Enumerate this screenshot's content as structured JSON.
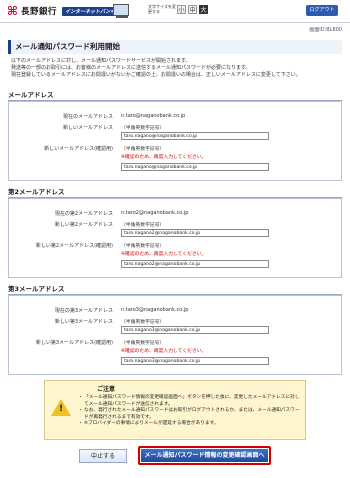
{
  "header": {
    "bank_name": "長野銀行",
    "service_badge": "インターネットバンキング",
    "font_size_label": "文字サイズを変更する",
    "font_sizes": [
      "小",
      "中",
      "大"
    ],
    "logout_label": "ログアウト"
  },
  "screen_id": "画面ID:BL800",
  "title": "メール通知パスワード利用開始",
  "intro_lines": [
    "以下のメールアドレスに対し、メール通知パスワードサービスが開始されます。",
    "発送等の一部のお取引には、お客様のメールアドレスに送信するメール通知パスワードが必要になります。",
    "現在登録しているメールアドレスにお間違いがないかご確認の上、お間違いの場合は、正しいメールアドレスに変更して下さい。"
  ],
  "sections": [
    {
      "heading": "メールアドレス",
      "current_label": "現在のメールアドレス",
      "current_value": "n.taro@naganobank.co.jp",
      "new_label": "新しいメールアドレス",
      "hint": "（半角英数字記号）",
      "new_value": "taro.nagano@naganobank.co.jp",
      "confirm_label": "新しいメールアドレス(確認用)",
      "confirm_note": "※確認のため、再度入力してください。",
      "confirm_value": "taro.nagano@naganobank.co.jp"
    },
    {
      "heading": "第2メールアドレス",
      "current_label": "現在の第2メールアドレス",
      "current_value": "n.taro2@naganobank.co.jp",
      "new_label": "新しい第2メールアドレス",
      "hint": "（半角英数字記号）",
      "new_value": "taro.nagano2@naganobank.co.jp",
      "confirm_label": "新しい第2メールアドレス(確認用)",
      "confirm_note": "※確認のため、再度入力してください。",
      "confirm_value": "taro.nagano2@naganobank.co.jp"
    },
    {
      "heading": "第3メールアドレス",
      "current_label": "現在の第3メールアドレス",
      "current_value": "n.taro3@naganobank.co.jp",
      "new_label": "新しい第3メールアドレス",
      "hint": "（半角英数字記号）",
      "new_value": "taro.nagano3@naganobank.co.jp",
      "confirm_label": "新しい第3メールアドレス(確認用)",
      "confirm_note": "※確認のため、再度入力してください。",
      "confirm_value": "taro.nagano3@naganobank.co.jp"
    }
  ],
  "caution": {
    "heading": "ご注意",
    "items": [
      "「メール通知パスワード情報の変更確認画面へ」ボタンを押した後に、変更したメールアドレスに対してメール通知パスワードが送信されます。",
      "なお、発行されたメール通知パスワードはお取引がログアウトされるか、または、メール通知パスワードが再発行されるまで有効です。",
      "※プロバイダーの事情によりメールが遅延する場合があります。"
    ]
  },
  "buttons": {
    "cancel": "中止する",
    "next": "メール通知パスワード情報の変更確認画面へ"
  },
  "colors": {
    "brand": "#1e3f8a",
    "alert": "#d00000",
    "caution_bg": "#fff6cf"
  }
}
